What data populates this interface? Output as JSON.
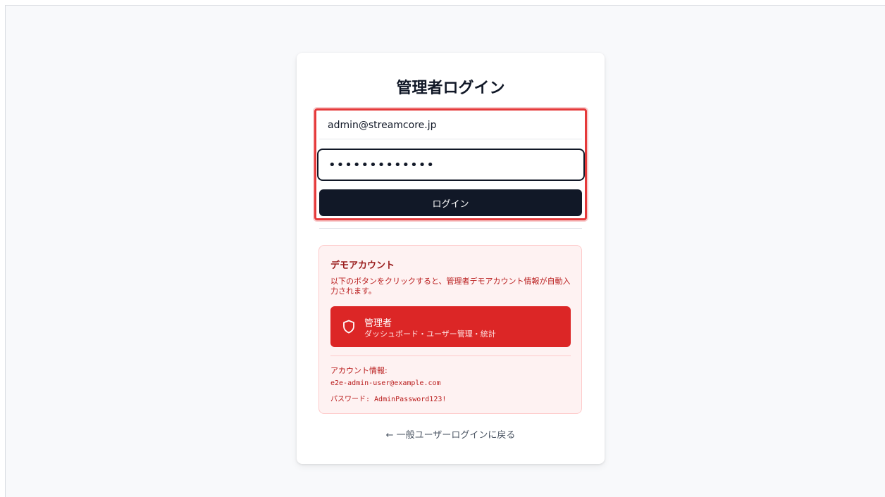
{
  "page": {
    "title": "管理者ログイン"
  },
  "form": {
    "email_value": "admin@streamcore.jp",
    "password_value": "•••••••••••••",
    "login_button_label": "ログイン"
  },
  "demo": {
    "title": "デモアカウント",
    "description": "以下のボタンをクリックすると、管理者デモアカウント情報が自動入力されます。",
    "admin_button": {
      "icon": "shield-icon",
      "label": "管理者",
      "subtitle": "ダッシュボード・ユーザー管理・統計"
    },
    "account_info_heading": "アカウント情報:",
    "account_email": "e2e-admin-user@example.com",
    "account_password_line": "パスワード: AdminPassword123!"
  },
  "back_link": {
    "label": "← 一般ユーザーログインに戻る"
  },
  "colors": {
    "primary_dark": "#111827",
    "danger": "#dc2626",
    "danger_bg": "#fef2f2",
    "highlight": "#e5393a"
  }
}
